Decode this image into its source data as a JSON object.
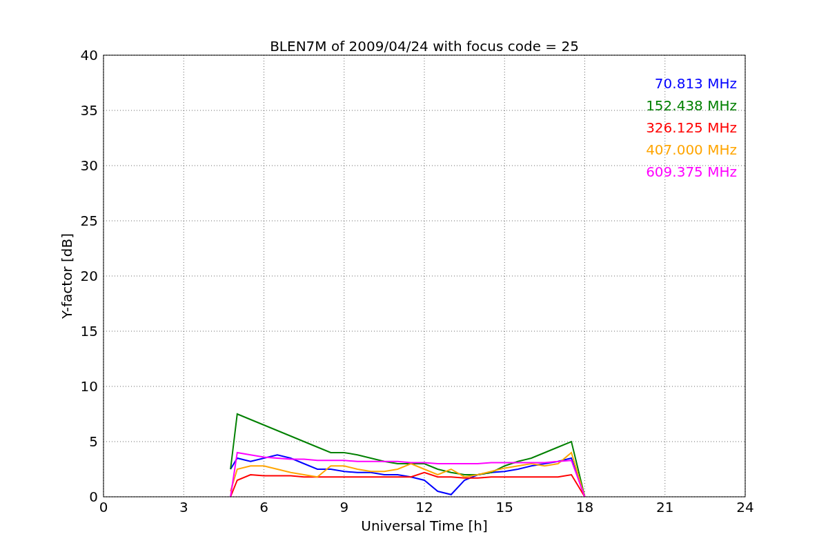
{
  "figure": {
    "chart_data": {
      "type": "line",
      "title": "BLEN7M of 2009/04/24 with focus code = 25",
      "xlabel": "Universal Time [h]",
      "ylabel": "Y-factor [dB]",
      "x": [
        4.75,
        5,
        5.5,
        6,
        6.5,
        7,
        7.5,
        8,
        8.5,
        9,
        9.5,
        10,
        10.5,
        11,
        11.5,
        12,
        12.5,
        13,
        13.5,
        14,
        14.5,
        15,
        15.5,
        16,
        16.5,
        17,
        17.5,
        18
      ],
      "series": [
        {
          "name": "70.813 MHz",
          "color": "#0000ff",
          "values": [
            2.5,
            3.5,
            3.2,
            3.5,
            3.8,
            3.5,
            3.0,
            2.5,
            2.5,
            2.3,
            2.2,
            2.2,
            2.0,
            2.0,
            1.8,
            1.5,
            0.5,
            0.2,
            1.5,
            2,
            2.2,
            2.3,
            2.5,
            2.8,
            3.0,
            3.2,
            3.5,
            0
          ]
        },
        {
          "name": "152.438 MHz",
          "color": "#008000",
          "values": [
            2.5,
            7.5,
            7,
            6.5,
            6,
            5.5,
            5,
            4.5,
            4,
            4,
            3.8,
            3.5,
            3.2,
            3,
            3,
            3,
            2.5,
            2.2,
            2,
            2,
            2.2,
            2.8,
            3.2,
            3.5,
            4,
            4.5,
            5,
            0
          ]
        },
        {
          "name": "326.125 MHz",
          "color": "#ff0000",
          "values": [
            0,
            1.5,
            2,
            1.9,
            1.9,
            1.9,
            1.8,
            1.8,
            1.8,
            1.8,
            1.8,
            1.8,
            1.8,
            1.8,
            1.8,
            2.2,
            1.8,
            1.8,
            1.7,
            1.7,
            1.8,
            1.8,
            1.8,
            1.8,
            1.8,
            1.8,
            2.0,
            0
          ]
        },
        {
          "name": "407.000 MHz",
          "color": "#ffa500",
          "values": [
            0.5,
            2.5,
            2.8,
            2.8,
            2.5,
            2.2,
            2,
            1.8,
            2.8,
            2.8,
            2.5,
            2.3,
            2.3,
            2.5,
            3,
            2.5,
            2,
            2.5,
            1.8,
            2,
            2.3,
            2.6,
            2.8,
            3,
            2.8,
            3,
            4,
            0
          ]
        },
        {
          "name": "609.375 MHz",
          "color": "#ff00ff",
          "values": [
            0,
            4,
            3.8,
            3.6,
            3.5,
            3.4,
            3.4,
            3.3,
            3.3,
            3.3,
            3.2,
            3.2,
            3.2,
            3.2,
            3.1,
            3.1,
            3.0,
            3.0,
            3.0,
            3.0,
            3.1,
            3.1,
            3.1,
            3.1,
            3.1,
            3.2,
            3.3,
            0
          ]
        }
      ],
      "grid": true,
      "xlim": [
        0,
        24
      ],
      "ylim": [
        0,
        40
      ],
      "xticks": [
        0,
        3,
        6,
        9,
        12,
        15,
        18,
        21,
        24
      ],
      "yticks": [
        0,
        5,
        10,
        15,
        20,
        25,
        30,
        35,
        40
      ]
    }
  }
}
